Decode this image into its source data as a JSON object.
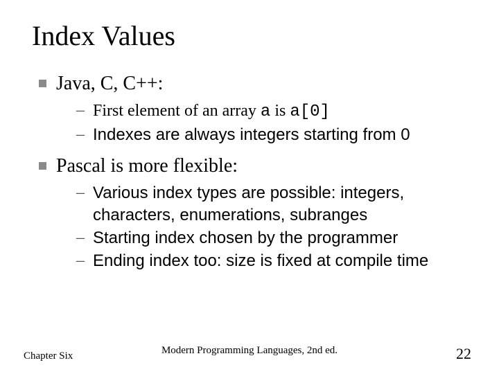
{
  "title": "Index Values",
  "bullets": [
    {
      "text": "Java, C, C++:",
      "sub": [
        {
          "pre": "First element of an array ",
          "code1": "a",
          "mid": " is ",
          "code2": "a[0]"
        },
        {
          "pre": "Indexes are always integers starting from 0"
        }
      ]
    },
    {
      "text": "Pascal is more flexible:",
      "sub": [
        {
          "pre": "Various index types are possible: integers, characters, enumerations, subranges"
        },
        {
          "pre": "Starting index chosen by the programmer"
        },
        {
          "pre": "Ending index too: size is fixed at compile time"
        }
      ]
    }
  ],
  "footer": {
    "left": "Chapter Six",
    "center": "Modern Programming Languages, 2nd ed.",
    "right": "22"
  }
}
